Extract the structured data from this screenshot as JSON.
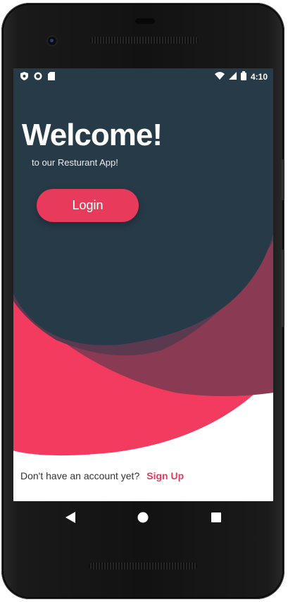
{
  "statusbar": {
    "left_icons": [
      "shield-icon",
      "circle-record-icon",
      "sd-card-icon"
    ],
    "right_icons": [
      "wifi-icon",
      "cell-signal-icon",
      "battery-icon"
    ],
    "time": "4:10"
  },
  "hero": {
    "title": "Welcome!",
    "subtitle": "to our Resturant App!"
  },
  "login": {
    "label": "Login"
  },
  "signup": {
    "prompt": "Don't have an account yet?",
    "link_label": "Sign Up"
  },
  "navbar": {
    "icons": [
      "back-icon",
      "home-icon",
      "recents-icon"
    ]
  },
  "colors": {
    "navy": "#273a48",
    "accent": "#f23b5f",
    "wave_mid": "#8a3b53",
    "wave_dark": "#5b3a4f",
    "white": "#ffffff"
  }
}
